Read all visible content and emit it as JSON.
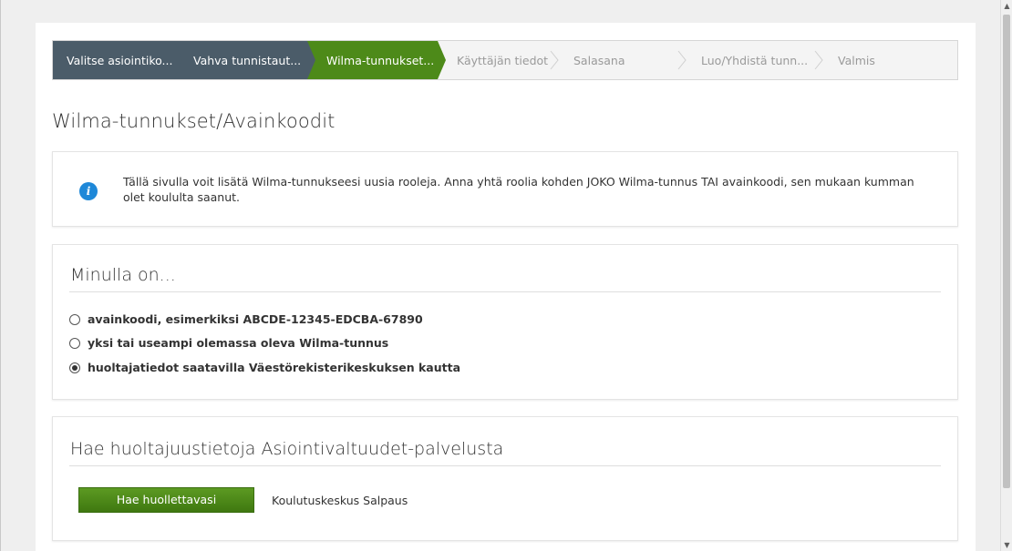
{
  "stepper": {
    "steps": [
      {
        "label": "Valitse asiointiko...",
        "state": "done"
      },
      {
        "label": "Vahva tunnistaut...",
        "state": "done"
      },
      {
        "label": "Wilma-tunnukset...",
        "state": "active"
      },
      {
        "label": "Käyttäjän tiedot",
        "state": "pending"
      },
      {
        "label": "Salasana",
        "state": "pending"
      },
      {
        "label": "Luo/Yhdistä tunn...",
        "state": "pending"
      },
      {
        "label": "Valmis",
        "state": "pending"
      }
    ]
  },
  "page": {
    "title": "Wilma-tunnukset/Avainkoodit"
  },
  "info": {
    "icon": "info-icon",
    "icon_glyph": "i",
    "text": "Tällä sivulla voit lisätä Wilma-tunnukseesi uusia rooleja. Anna yhtä roolia kohden JOKO Wilma-tunnus TAI avainkoodi, sen mukaan kumman olet koululta saanut."
  },
  "options_section": {
    "title": "Minulla on...",
    "options": [
      {
        "label": "avainkoodi, esimerkiksi ABCDE-12345-EDCBA-67890",
        "checked": false
      },
      {
        "label": "yksi tai useampi olemassa oleva Wilma-tunnus",
        "checked": false
      },
      {
        "label": "huoltajatiedot saatavilla Väestörekisterikeskuksen kautta",
        "checked": true
      }
    ]
  },
  "search_section": {
    "title": "Hae huoltajuustietoja Asiointivaltuudet-palvelusta",
    "button_label": "Hae huollettavasi",
    "organization": "Koulutuskeskus Salpaus"
  },
  "colors": {
    "step_done": "#4b5c69",
    "step_active": "#4d8a19",
    "step_pending": "#f4f4f4",
    "info_icon": "#1e88d8",
    "primary_button": "#4d8a19"
  }
}
